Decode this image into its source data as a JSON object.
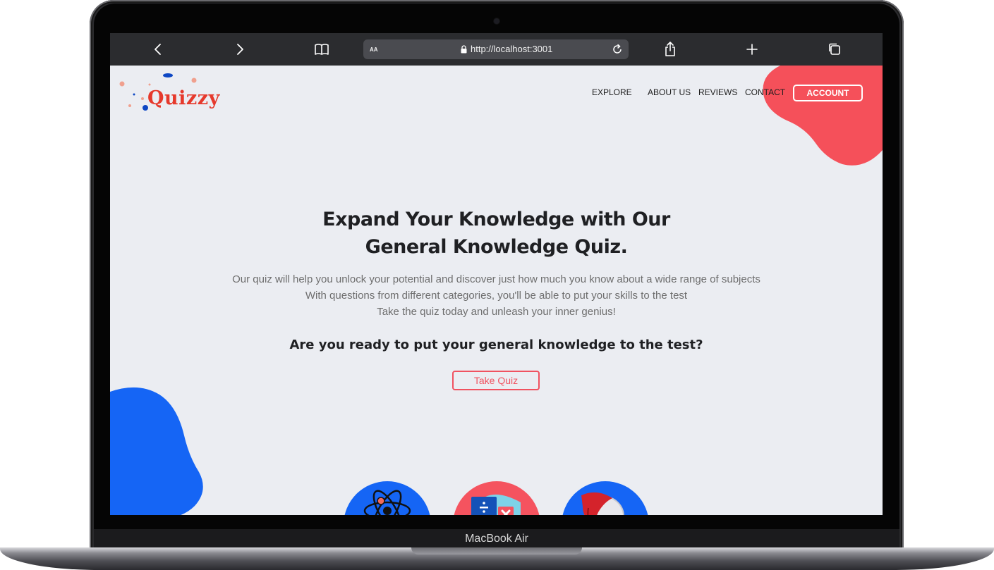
{
  "device": {
    "label": "MacBook Air"
  },
  "browser": {
    "url": "http://localhost:3001",
    "reader_label": "AA",
    "icons": [
      "back-icon",
      "forward-icon",
      "bookmarks-icon",
      "lock-icon",
      "reload-icon",
      "share-icon",
      "new-tab-icon",
      "tabs-icon"
    ]
  },
  "site": {
    "logo": "Quizzy",
    "nav": {
      "explore": "EXPLORE",
      "about": "ABOUT US",
      "reviews": "REVIEWS",
      "contact": "CONTACT",
      "account": "ACCOUNT"
    },
    "hero": {
      "title_line1": "Expand Your Knowledge with Our",
      "title_line2": "General Knowledge Quiz.",
      "desc_line1": "Our quiz will help you unlock your potential and discover just how much you know about a wide range of subjects",
      "desc_line2": "With questions from different categories, you'll be able to put your skills to the test",
      "desc_line3": "Take the quiz today and unleash your inner genius!",
      "question": "Are you ready to put your general knowledge to the test?",
      "cta": "Take Quiz"
    },
    "categories": [
      {
        "icon": "atom-icon",
        "color": "#1565f5"
      },
      {
        "icon": "math-icon",
        "color": "#f5535f"
      },
      {
        "icon": "globe-icon",
        "color": "#1565f5"
      }
    ],
    "colors": {
      "accent_red": "#f5505a",
      "accent_blue": "#1565f5",
      "logo_red": "#e6392c",
      "page_bg": "#ebedf2"
    }
  }
}
